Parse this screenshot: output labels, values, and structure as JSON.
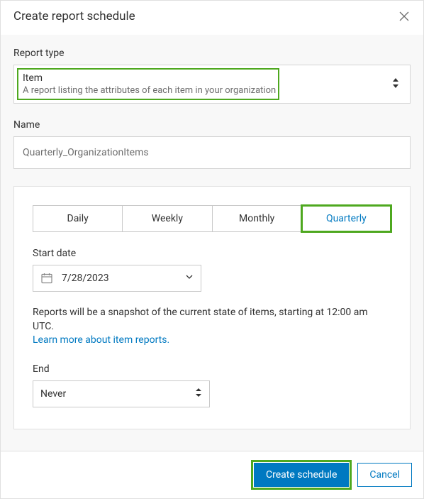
{
  "dialog": {
    "title": "Create report schedule"
  },
  "reportType": {
    "label": "Report type",
    "selected": {
      "title": "Item",
      "description": "A report listing the attributes of each item in your organization"
    }
  },
  "name": {
    "label": "Name",
    "value": "Quarterly_OrganizationItems"
  },
  "frequency": {
    "tabs": [
      "Daily",
      "Weekly",
      "Monthly",
      "Quarterly"
    ],
    "activeIndex": 3
  },
  "startDate": {
    "label": "Start date",
    "value": "7/28/2023"
  },
  "info": {
    "text": "Reports will be a snapshot of the current state of items, starting at 12:00 am UTC.",
    "linkText": "Learn more about item reports."
  },
  "end": {
    "label": "End",
    "value": "Never"
  },
  "footer": {
    "primary": "Create schedule",
    "secondary": "Cancel"
  }
}
